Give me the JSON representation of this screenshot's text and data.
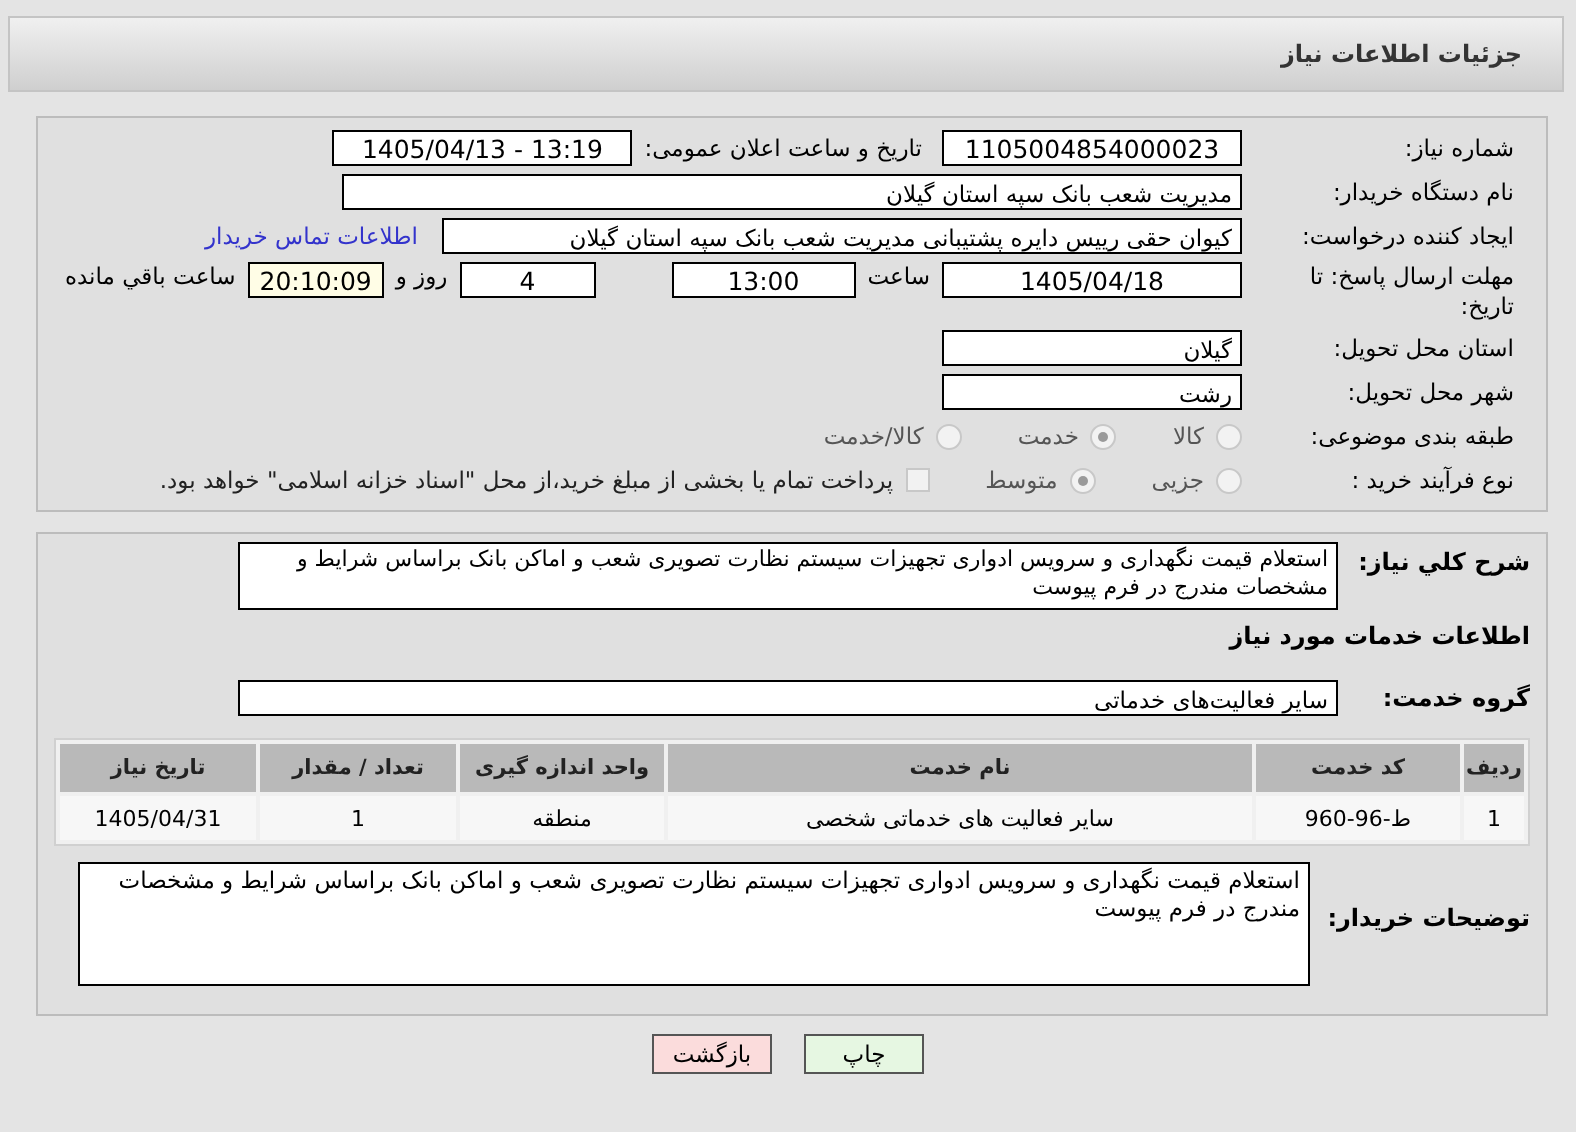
{
  "header": {
    "title": "جزئیات اطلاعات نیاز"
  },
  "form": {
    "need_number": {
      "label": "شماره نیاز:",
      "value": "1105004854000023"
    },
    "announce": {
      "label": "تاریخ و ساعت اعلان عمومی:",
      "value": "1405/04/13 - 13:19"
    },
    "buyer": {
      "label": "نام دستگاه خریدار:",
      "value": "مدیریت شعب بانک سپه استان گیلان"
    },
    "creator": {
      "label": "ایجاد کننده درخواست:",
      "value": "کیوان حقی رییس دایره پشتیبانی  مدیریت شعب بانک سپه استان گیلان",
      "link": "اطلاعات تماس خریدار"
    },
    "deadline": {
      "label": "مهلت ارسال پاسخ: تا تاریخ:",
      "date": "1405/04/18",
      "time_label": "ساعت",
      "time": "13:00",
      "days": "4",
      "days_label": "روز و",
      "remaining": "20:10:09",
      "remaining_label": "ساعت باقي مانده"
    },
    "province": {
      "label": "استان محل تحویل:",
      "value": "گیلان"
    },
    "city": {
      "label": "شهر محل تحویل:",
      "value": "رشت"
    },
    "category": {
      "label": "طبقه بندی موضوعی:",
      "options": [
        {
          "label": "کالا",
          "selected": false
        },
        {
          "label": "خدمت",
          "selected": true
        },
        {
          "label": "کالا/خدمت",
          "selected": false
        }
      ]
    },
    "process": {
      "label": "نوع فرآیند خرید :",
      "options": [
        {
          "label": "جزیی",
          "selected": false
        },
        {
          "label": "متوسط",
          "selected": true
        }
      ],
      "treasury": {
        "label": "پرداخت تمام یا بخشی از مبلغ خرید،از محل \"اسناد خزانه اسلامی\" خواهد بود.",
        "checked": false
      }
    }
  },
  "details": {
    "summary": {
      "label": "شرح کلي نياز:",
      "value": "استعلام قیمت نگهداری و سرویس ادواری تجهیزات سیستم نظارت تصویری شعب و اماکن بانک براساس شرایط و مشخصات مندرج در فرم پیوست"
    },
    "section_title": "اطلاعات خدمات مورد نیاز",
    "service_group": {
      "label": "گروه خدمت:",
      "value": "سایر فعالیت‌های خدماتی"
    },
    "table": {
      "columns": [
        "ردیف",
        "کد خدمت",
        "نام خدمت",
        "واحد اندازه گیری",
        "تعداد / مقدار",
        "تاریخ نیاز"
      ],
      "rows": [
        [
          "1",
          "ط-96-960",
          "سایر فعالیت های خدماتی شخصی",
          "منطقه",
          "1",
          "1405/04/31"
        ]
      ]
    },
    "buyer_notes": {
      "label": "توضیحات خریدار:",
      "value": "استعلام قیمت نگهداری و سرویس ادواری تجهیزات سیستم نظارت تصویری شعب و اماکن بانک براساس شرایط و مشخصات مندرج در فرم پیوست"
    }
  },
  "buttons": [
    {
      "label": "چاپ",
      "kind": "print"
    },
    {
      "label": "بازگشت",
      "kind": "back"
    }
  ]
}
